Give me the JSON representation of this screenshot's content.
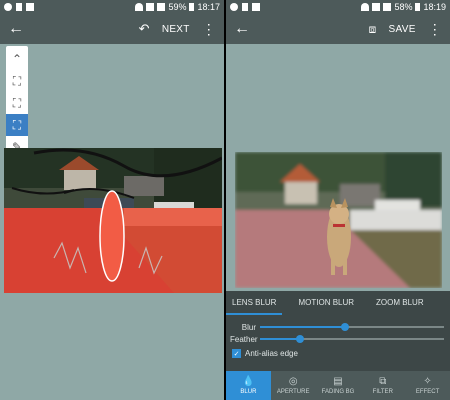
{
  "left": {
    "status": {
      "battery": "59%",
      "time": "18:17"
    },
    "appbar": {
      "next_label": "NEXT"
    },
    "tools": [
      {
        "name": "collapse-icon",
        "glyph": "⌃",
        "active": false
      },
      {
        "name": "face-detect-icon",
        "glyph": "⛶",
        "active": false
      },
      {
        "name": "object-select-icon",
        "glyph": "⛶",
        "active": false
      },
      {
        "name": "smart-select-icon",
        "glyph": "⛶",
        "active": true
      },
      {
        "name": "brush-icon",
        "glyph": "✎",
        "active": false
      },
      {
        "name": "eraser-icon",
        "glyph": "⌫",
        "active": false
      },
      {
        "name": "zoom-in-icon",
        "glyph": "⊕",
        "active": false
      },
      {
        "name": "preview-icon",
        "glyph": "◉",
        "active": false
      }
    ]
  },
  "right": {
    "status": {
      "battery": "58%",
      "time": "18:19"
    },
    "appbar": {
      "save_label": "SAVE"
    },
    "tabs": [
      "LENS BLUR",
      "MOTION BLUR",
      "ZOOM BLUR"
    ],
    "sliders": {
      "blur": {
        "label": "Blur",
        "value": 0.46
      },
      "feather": {
        "label": "Feather",
        "value": 0.22
      }
    },
    "antialias_label": "Anti-alias edge",
    "nav": [
      {
        "label": "BLUR",
        "icon": "drop-icon",
        "glyph": "💧",
        "active": true
      },
      {
        "label": "APERTURE",
        "icon": "aperture-icon",
        "glyph": "◎",
        "active": false
      },
      {
        "label": "FADING BG",
        "icon": "fading-icon",
        "glyph": "▤",
        "active": false
      },
      {
        "label": "FILTER",
        "icon": "filter-icon",
        "glyph": "⧉",
        "active": false
      },
      {
        "label": "EFFECT",
        "icon": "effect-icon",
        "glyph": "✧",
        "active": false
      }
    ]
  },
  "colors": {
    "accent": "#2f8fd6",
    "appbar": "#4d5a5a",
    "canvas": "#8fa8a6",
    "mask": "#e8503a"
  }
}
